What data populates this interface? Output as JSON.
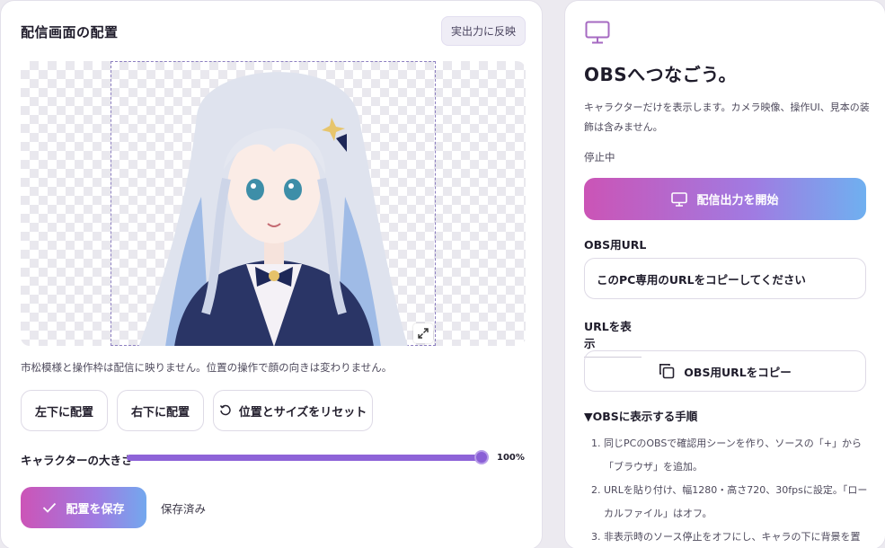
{
  "placement": {
    "title": "配信画面の配置",
    "apply_label": "実出力に反映",
    "note": "市松模様と操作枠は配信に映りません。位置の操作で顔の向きは変わりません。",
    "bottom_left_label": "左下に配置",
    "bottom_right_label": "右下に配置",
    "reset_label": "位置とサイズをリセット",
    "size_label": "キャラクターの大きさ",
    "size_value": "100%",
    "size_level": 1.0,
    "save_label": "配置を保存",
    "saved_status": "保存済み"
  },
  "obs": {
    "title": "OBSへつなごう。",
    "description": "キャラクターだけを表示します。カメラ映像、操作UI、見本の装飾は含みません。",
    "status": "停止中",
    "start_label": "配信出力を開始",
    "url_label": "OBS用URL",
    "url_placeholder": "このPC専用のURLをコピーしてください",
    "show_url_label": "URLを表示",
    "copy_label": "OBS用URLをコピー",
    "steps_title": "▼OBSに表示する手順",
    "steps": [
      {
        "num": "1.",
        "text": "同じPCのOBSで確認用シーンを作り、ソースの「+」から「ブラウザ」を追加。"
      },
      {
        "num": "2.",
        "text": "URLを貼り付け、幅1280・高さ720、30fpsに設定。「ローカルファイル」はオフ。"
      },
      {
        "num": "3.",
        "text": "非表示時のソース停止をオフにし、キャラの下に背景を置"
      }
    ]
  },
  "colors": {
    "accent_purple": "#8e63d8",
    "gradient_start": "#cb54b6",
    "gradient_end": "#6fb0f0"
  },
  "icons": [
    "monitor-icon",
    "check-icon",
    "reset-icon",
    "copy-icon",
    "expand-icon"
  ]
}
